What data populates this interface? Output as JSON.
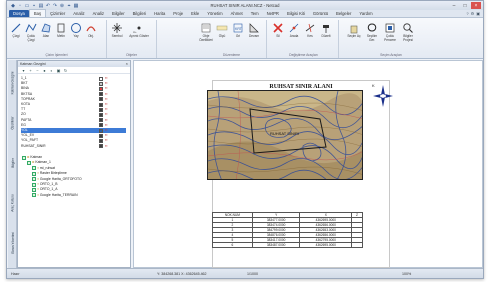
{
  "app": {
    "title": "RUHSAT SINIR ALANI.NCZ - Netcad",
    "menu_tabs": [
      "Dosya",
      "Baş",
      "Çizimler",
      "Analiz",
      "Analiz",
      "Bilgiler",
      "Bilgileri",
      "Harita",
      "Proje",
      "Ekle",
      "Yönetim",
      "Ahmet",
      "Tem",
      "NetPR",
      "Bilgisi Kiti",
      "Görüntü",
      "Belgeler",
      "Yardım"
    ],
    "active_tab_index": 1,
    "colors": {
      "file_tab": "#2a5ea8",
      "accent": "#3a5f94"
    }
  },
  "ribbon": {
    "groups": [
      {
        "label": "Çizim İşlemleri",
        "buttons": [
          "Çizgi",
          "Çoklu Çizgi",
          "Alan",
          "Metin",
          "Yay",
          "Obj."
        ]
      },
      {
        "label": "Objeler",
        "buttons": [
          "Sembol",
          "Nokta"
        ]
      },
      {
        "label": "Düzenleme",
        "buttons": [
          "Obje Özellikleri",
          "Ölçü",
          "Gri",
          "Devam"
        ]
      },
      {
        "label": "Değiştirme Araçları",
        "buttons": [
          "Sil",
          "Arada",
          "Kes",
          "Düzelt"
        ]
      },
      {
        "label": "Seçim Araçları",
        "buttons": [
          "Seçim Aç",
          "Seçilim Ger.",
          "Çoklu Pencere",
          "Bilgiler Projesi"
        ]
      }
    ],
    "small_button": "Ayrıntı Göster"
  },
  "left_panel": {
    "title": "Katman Gezgini",
    "layers": [
      {
        "name": "1_1",
        "color": "#ffffff"
      },
      {
        "name": "BKT",
        "color": "#c8c8c8"
      },
      {
        "name": "BINA",
        "color": "#e04040"
      },
      {
        "name": "BKTSA",
        "color": "#404040"
      },
      {
        "name": "TOPRAK",
        "color": "#404040"
      },
      {
        "name": "KOTA",
        "color": "#404040"
      },
      {
        "name": "TT",
        "color": "#404040"
      },
      {
        "name": "ZO",
        "color": "#404040"
      },
      {
        "name": "PAFTA",
        "color": "#404040"
      },
      {
        "name": "EG",
        "color": "#404040"
      },
      {
        "name": "YOL",
        "color": "#2a5ea8"
      },
      {
        "name": "YOL_EV",
        "color": "#404040"
      },
      {
        "name": "YOL_PAFT",
        "color": "#404040"
      },
      {
        "name": "RUHSAT_SINIR",
        "color": "#404040"
      }
    ],
    "selected_layer_index": 10,
    "tree": [
      {
        "label": "Katman",
        "level": 0
      },
      {
        "label": "Katman_1",
        "level": 1
      },
      {
        "label": "rst_ruhsat",
        "level": 2
      },
      {
        "label": "Raster Birleştirme",
        "level": 2
      },
      {
        "label": "Google Harita_ORTOFOTO",
        "level": 2
      },
      {
        "label": "ORTO_1_B",
        "level": 2
      },
      {
        "label": "ORTO_1_A",
        "level": 2
      },
      {
        "label": "Google Harita_TERRAIN",
        "level": 2
      }
    ],
    "vertical_tabs": [
      "Katman Gezgini",
      "Özellikler",
      "Bilgiler",
      "Araç Kutusu",
      "Ekran Yönetimi"
    ]
  },
  "canvas": {
    "map_title": "RUHSAT SINIR ALANI",
    "north_label": "K",
    "license_label": "RUHSAT SINIRI",
    "table": {
      "headers": [
        "NOK.NUM",
        "Y",
        "X",
        "Z"
      ],
      "rows": [
        [
          "1",
          "383477.0000",
          "4362695.0000",
          ""
        ],
        [
          "2",
          "383474.0000",
          "4362656.0000",
          ""
        ],
        [
          "3",
          "384799.0000",
          "4362653.0000",
          ""
        ],
        [
          "4",
          "384876.0000",
          "4362656.0000",
          ""
        ],
        [
          "5",
          "383417.0000",
          "4362795.0000",
          ""
        ],
        [
          "6",
          "383487.0000",
          "4362695.0000",
          ""
        ]
      ]
    }
  },
  "status": {
    "left": "Hazır",
    "coords": "Y: 384268.381  X: 4362645.462",
    "scale": "1/1000",
    "zoom": "100%"
  }
}
